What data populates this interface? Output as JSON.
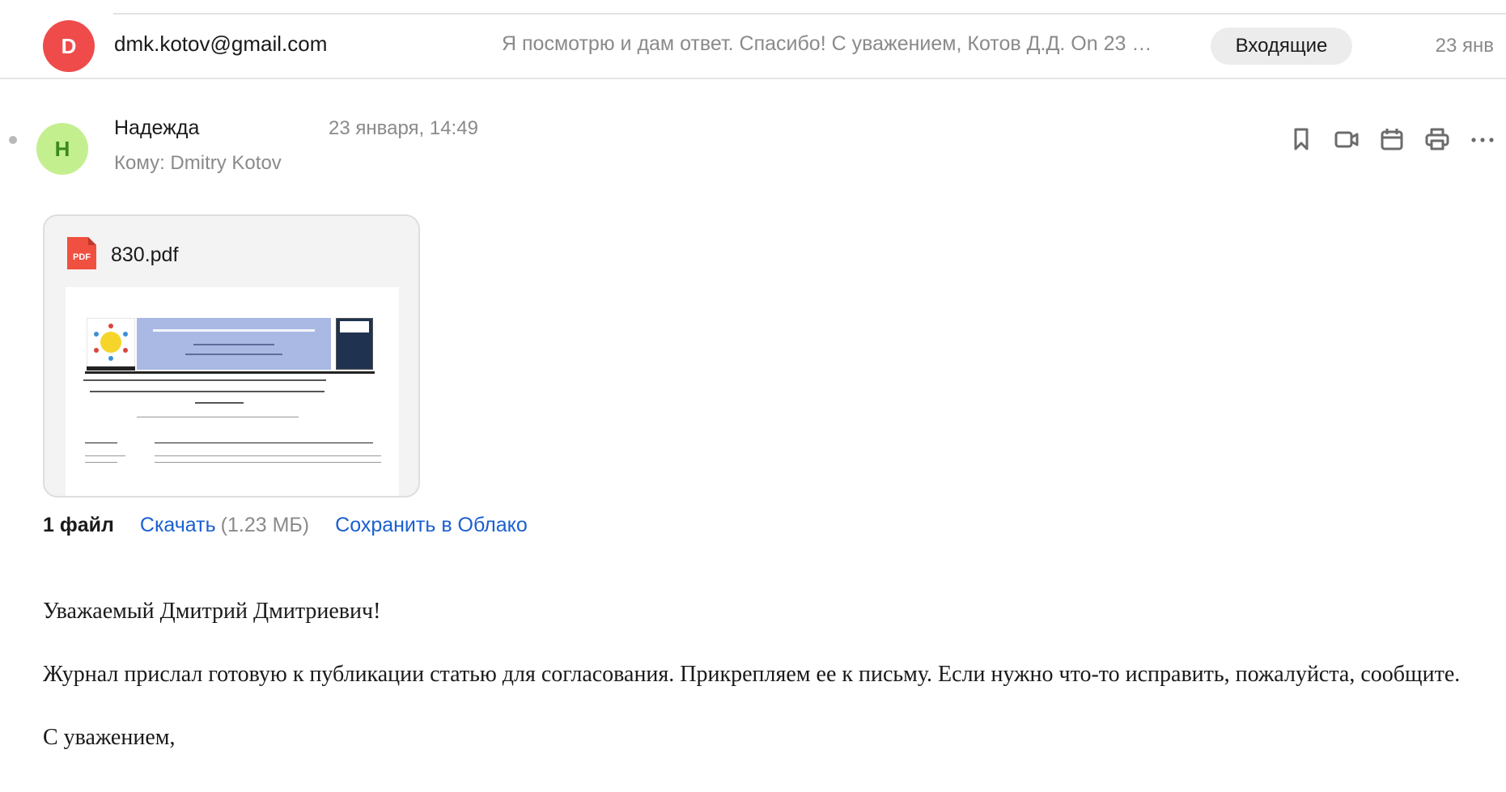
{
  "thread_row": {
    "avatar_letter": "D",
    "avatar_color": "#ef4b4b",
    "sender": "dmk.kotov@gmail.com",
    "snippet": "Я посмотрю и дам ответ. Спасибо! С уважением, Котов Д.Д. On 23 …",
    "folder": "Входящие",
    "date": "23 янв"
  },
  "message": {
    "avatar_letter": "Н",
    "avatar_color": "#c4ef8e",
    "from": "Надежда",
    "date": "23 января, 14:49",
    "to_line": "Кому: Dmitry Kotov",
    "toolbar": [
      {
        "name": "bookmark-icon"
      },
      {
        "name": "video-call-icon"
      },
      {
        "name": "calendar-icon"
      },
      {
        "name": "print-icon"
      },
      {
        "name": "more-icon"
      }
    ]
  },
  "attachment": {
    "icon_label": "PDF",
    "filename": "830.pdf",
    "count_label": "1 файл",
    "download_label": "Скачать",
    "size": "(1.23 МБ)",
    "save_cloud_label": "Сохранить в Облако"
  },
  "body": {
    "greeting": "Уважаемый Дмитрий Дмитриевич!",
    "paragraph": "Журнал прислал готовую к публикации статью для согласования. Прикрепляем ее к письму. Если нужно что-то исправить, пожалуйста, сообщите.",
    "closing": "С уважением,"
  },
  "colors": {
    "link": "#1a5fd0",
    "muted": "#8a8a8a",
    "pdf_red": "#f0503f"
  }
}
